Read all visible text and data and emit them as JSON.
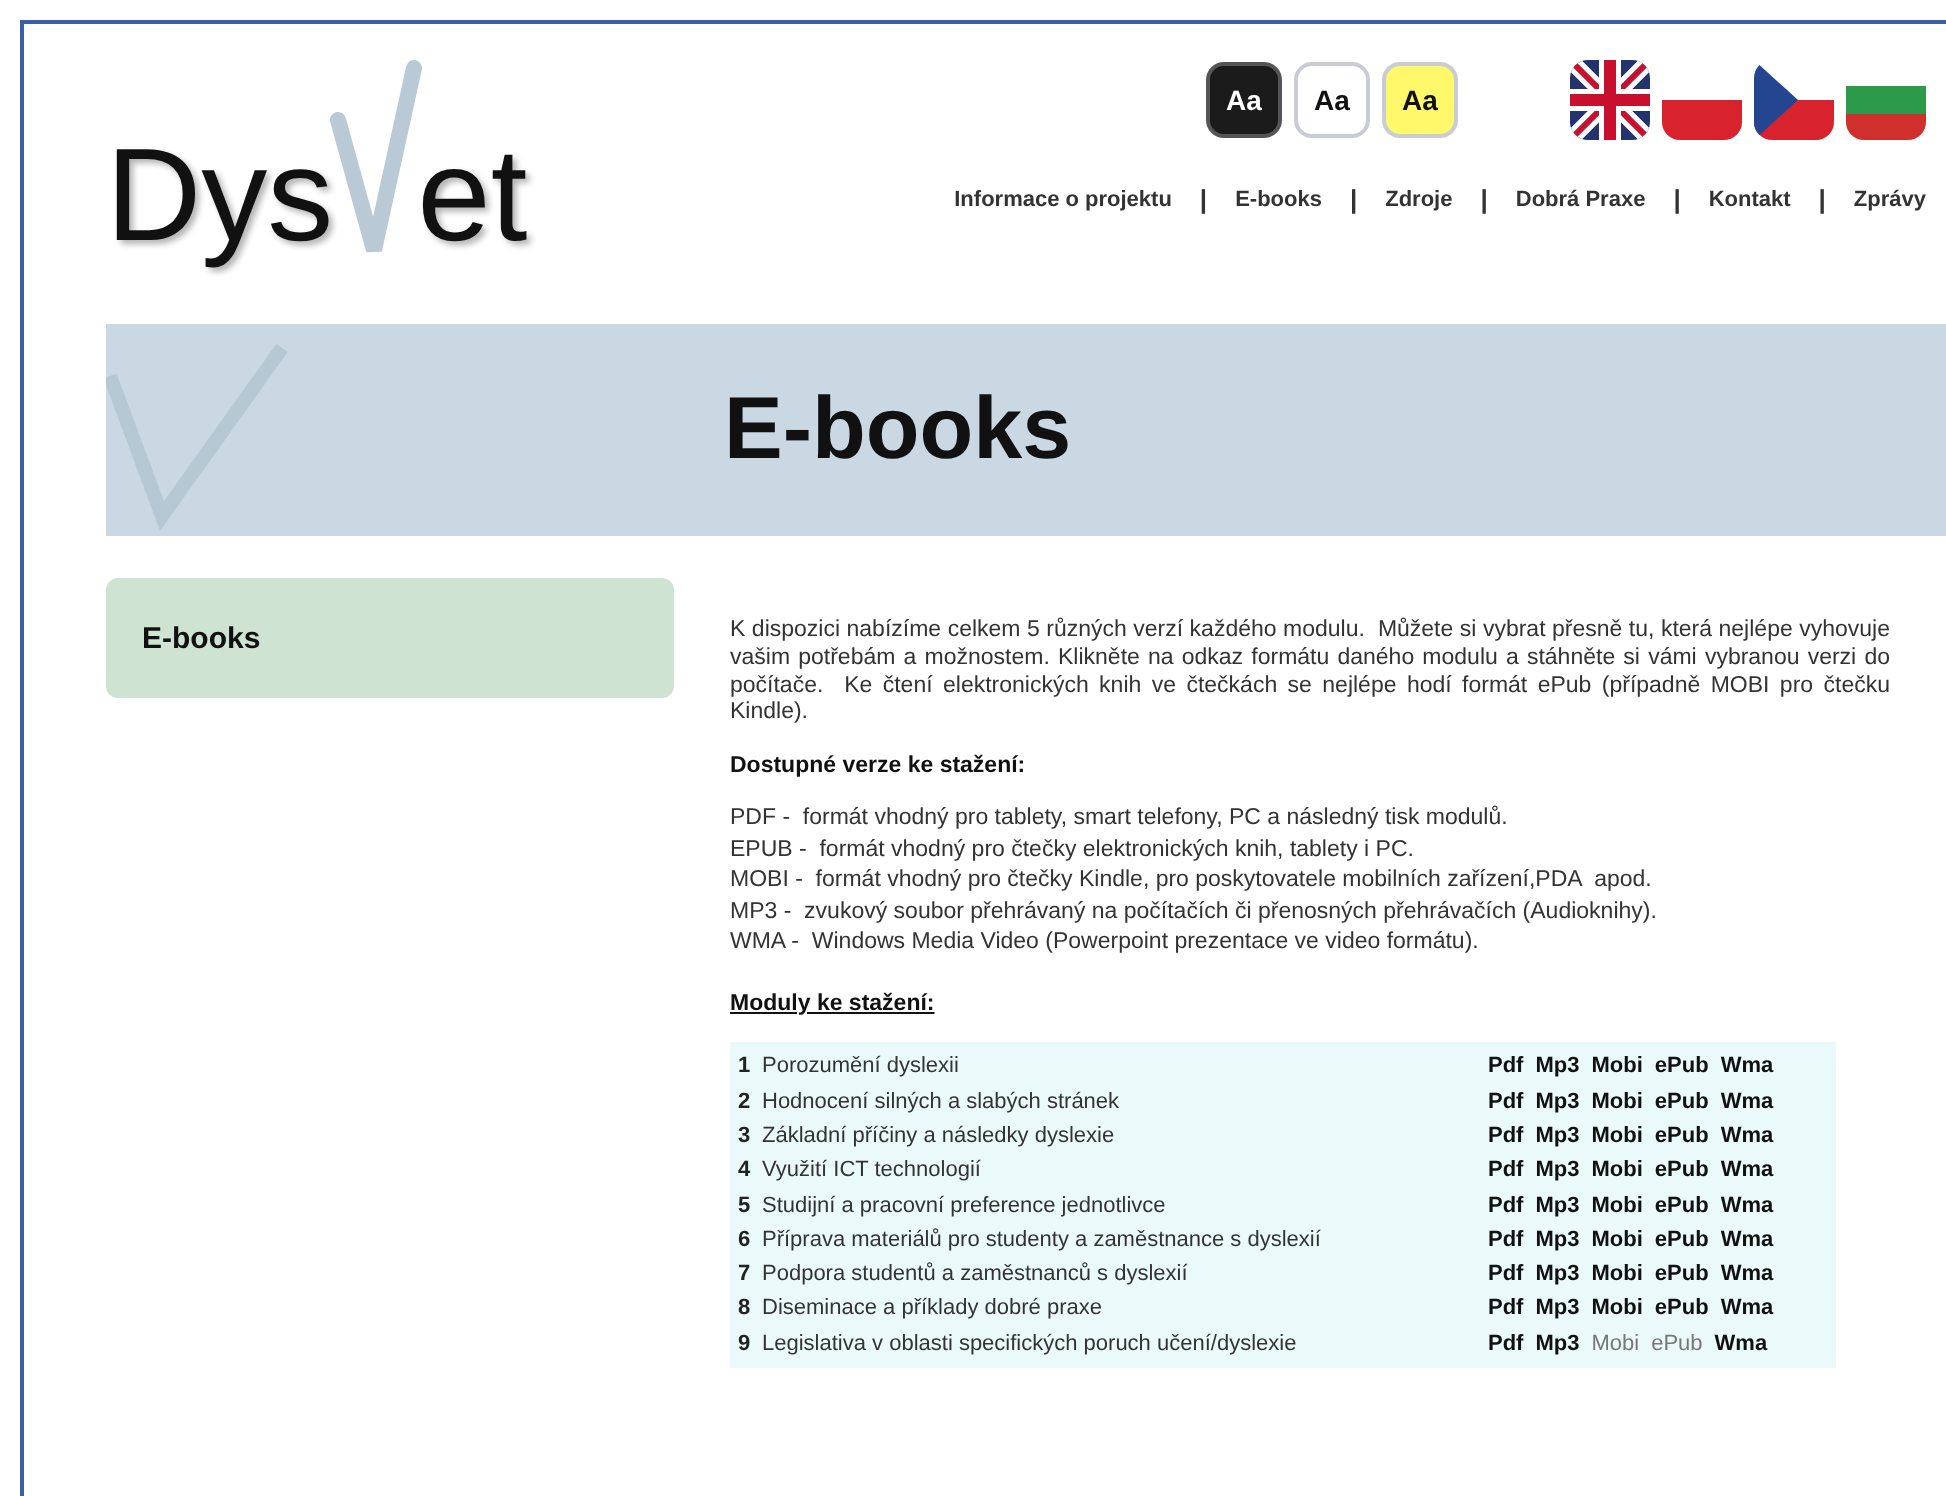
{
  "logo": {
    "left": "Dys",
    "right": "et"
  },
  "font_size_buttons": [
    {
      "label": "Aa",
      "kind": "dark"
    },
    {
      "label": "Aa",
      "kind": "white"
    },
    {
      "label": "Aa",
      "kind": "yellow"
    }
  ],
  "language_flags": [
    {
      "kind": "uk"
    },
    {
      "kind": "pl"
    },
    {
      "kind": "cz"
    },
    {
      "kind": "bg"
    }
  ],
  "nav": [
    "Informace o projektu",
    "E-books",
    "Zdroje",
    "Dobrá Praxe",
    "Kontakt",
    "Zprávy"
  ],
  "nav_separators": [
    "|",
    "|",
    "|",
    "|",
    "|"
  ],
  "banner": {
    "title": "E-books"
  },
  "sidebar": {
    "items": [
      {
        "label": "E-books",
        "selected": true
      }
    ]
  },
  "intro": "K dispozici nabízíme celkem 5 různých verzí každého modulu.  Můžete si vybrat přesně tu, která nejlépe vyhovuje vašim potřebám a možnostem. Klikněte na odkaz formátu daného modulu a stáhněte si vámi vybranou verzi do počítače.  Ke čtení elektronických knih ve čtečkách se nejlépe hodí formát ePub (případně MOBI pro čtečku Kindle).",
  "versions_heading": "Dostupné verze ke stažení:",
  "versions": [
    "PDF -  formát vhodný pro tablety, smart telefony, PC a následný tisk modulů.",
    "EPUB -  formát vhodný pro čtečky elektronických knih, tablety i PC.",
    "MOBI -  formát vhodný pro čtečky Kindle, pro poskytovatele mobilních zařízení,PDA  apod.",
    "MP3 -  zvukový soubor přehrávaný na počítačích či přenosných přehrávačích (Audioknihy).",
    "WMA -  Windows Media Video (Powerpoint prezentace ve video formátu)."
  ],
  "modules_heading": "Moduly ke stažení:",
  "modules": [
    {
      "number": "1",
      "title": "Porozumění dyslexii",
      "formats": [
        {
          "label": "Pdf",
          "available": true
        },
        {
          "label": "Mp3",
          "available": true
        },
        {
          "label": "Mobi",
          "available": true
        },
        {
          "label": "ePub",
          "available": true
        },
        {
          "label": "Wma",
          "available": true
        }
      ]
    },
    {
      "number": "2",
      "title": "Hodnocení silných a slabých stránek",
      "formats": [
        {
          "label": "Pdf",
          "available": true
        },
        {
          "label": "Mp3",
          "available": true
        },
        {
          "label": "Mobi",
          "available": true
        },
        {
          "label": "ePub",
          "available": true
        },
        {
          "label": "Wma",
          "available": true
        }
      ]
    },
    {
      "number": "3",
      "title": "Základní příčiny a následky dyslexie",
      "formats": [
        {
          "label": "Pdf",
          "available": true
        },
        {
          "label": "Mp3",
          "available": true
        },
        {
          "label": "Mobi",
          "available": true
        },
        {
          "label": "ePub",
          "available": true
        },
        {
          "label": "Wma",
          "available": true
        }
      ]
    },
    {
      "number": "4",
      "title": "Využití ICT technologií",
      "formats": [
        {
          "label": "Pdf",
          "available": true
        },
        {
          "label": "Mp3",
          "available": true
        },
        {
          "label": "Mobi",
          "available": true
        },
        {
          "label": "ePub",
          "available": true
        },
        {
          "label": "Wma",
          "available": true
        }
      ]
    },
    {
      "number": "5",
      "title": "Studijní a pracovní preference jednotlivce",
      "formats": [
        {
          "label": "Pdf",
          "available": true
        },
        {
          "label": "Mp3",
          "available": true
        },
        {
          "label": "Mobi",
          "available": true
        },
        {
          "label": "ePub",
          "available": true
        },
        {
          "label": "Wma",
          "available": true
        }
      ]
    },
    {
      "number": "6",
      "title": "Příprava materiálů pro studenty a zaměstnance s dyslexií",
      "formats": [
        {
          "label": "Pdf",
          "available": true
        },
        {
          "label": "Mp3",
          "available": true
        },
        {
          "label": "Mobi",
          "available": true
        },
        {
          "label": "ePub",
          "available": true
        },
        {
          "label": "Wma",
          "available": true
        }
      ]
    },
    {
      "number": "7",
      "title": "Podpora studentů a zaměstnanců s dyslexií",
      "formats": [
        {
          "label": "Pdf",
          "available": true
        },
        {
          "label": "Mp3",
          "available": true
        },
        {
          "label": "Mobi",
          "available": true
        },
        {
          "label": "ePub",
          "available": true
        },
        {
          "label": "Wma",
          "available": true
        }
      ]
    },
    {
      "number": "8",
      "title": "Diseminace a příklady dobré praxe",
      "formats": [
        {
          "label": "Pdf",
          "available": true
        },
        {
          "label": "Mp3",
          "available": true
        },
        {
          "label": "Mobi",
          "available": true
        },
        {
          "label": "ePub",
          "available": true
        },
        {
          "label": "Wma",
          "available": true
        }
      ]
    },
    {
      "number": "9",
      "title": "Legislativa v oblasti specifických poruch učení/dyslexie",
      "formats": [
        {
          "label": "Pdf",
          "available": true
        },
        {
          "label": "Mp3",
          "available": true
        },
        {
          "label": "Mobi",
          "available": false
        },
        {
          "label": "ePub",
          "available": false
        },
        {
          "label": "Wma",
          "available": true
        }
      ]
    }
  ]
}
